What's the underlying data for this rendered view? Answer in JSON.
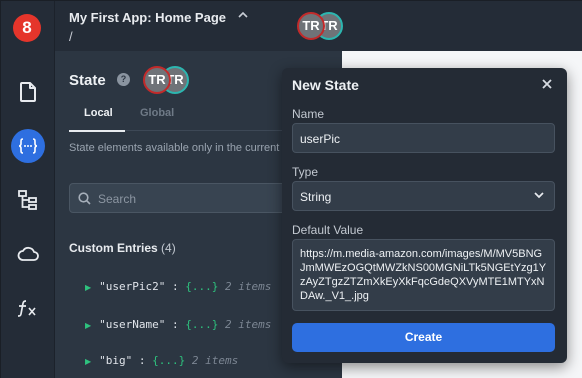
{
  "app": {
    "logo_text": "8",
    "title": "My First App: Home Page",
    "path": "/"
  },
  "collaborators": [
    {
      "initials": "TR",
      "ring_color": "#c22a2a"
    },
    {
      "initials": "TR",
      "ring_color": "#2cb6b0"
    }
  ],
  "rail": {
    "icons": [
      "page-icon",
      "state-braces-icon",
      "tree-icon",
      "cloud-icon",
      "function-icon"
    ],
    "active": "state-braces-icon"
  },
  "state_panel": {
    "title": "State",
    "tabs": [
      {
        "label": "Local",
        "active": true
      },
      {
        "label": "Global",
        "active": false
      }
    ],
    "description": "State elements available only in the current page.",
    "search_placeholder": "Search",
    "section_title": "Custom Entries",
    "section_count": "(4)",
    "entries": [
      {
        "key": "\"userPic2\"",
        "sep": " : ",
        "value": "{...}",
        "count": "2 items"
      },
      {
        "key": "\"userName\"",
        "sep": " : ",
        "value": "{...}",
        "count": "2 items"
      },
      {
        "key": "\"big\"",
        "sep": " : ",
        "value": "{...}",
        "count": "2 items"
      }
    ]
  },
  "modal": {
    "title": "New State",
    "name_label": "Name",
    "name_value": "userPic",
    "type_label": "Type",
    "type_value": "String",
    "default_label": "Default Value",
    "default_value": "https://m.media-amazon.com/images/M/MV5BNGJmMWEzOGQtMWZkNS00MGNiLTk5NGEtYzg1YzAyZTgzZTZmXkEyXkFqcGdeQXVyMTE1MTYxNDAw._V1_.jpg",
    "create_label": "Create"
  },
  "colors": {
    "accent": "#2e6fe0",
    "logo": "#e5352b",
    "tree_arrow": "#2ec27e"
  }
}
